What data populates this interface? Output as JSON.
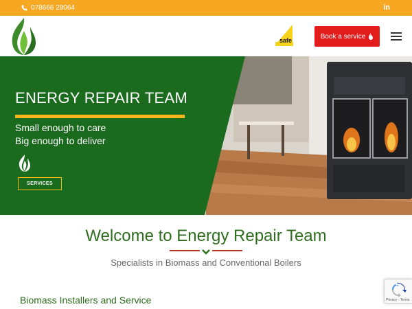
{
  "topbar": {
    "phone": "078666 28064",
    "social": "in"
  },
  "header": {
    "book_button": "Book a service"
  },
  "hero": {
    "title": "ENERGY REPAIR TEAM",
    "line1": "Small enough to care",
    "line2": "Big enough to deliver",
    "services_button": "SERVICES"
  },
  "main": {
    "welcome": "Welcome to Energy Repair Team",
    "subtitle": "Specialists in Biomass and Conventional Boilers",
    "section_heading": "Biomass Installers and Service"
  },
  "recaptcha": {
    "footer": "Privacy - Terms"
  },
  "colors": {
    "topbar": "#f7a823",
    "brand_green": "#1b6b1f",
    "heading_green": "#2e6e1e",
    "book_red": "#e21b1b",
    "accent_yellow": "#f5b51b"
  }
}
